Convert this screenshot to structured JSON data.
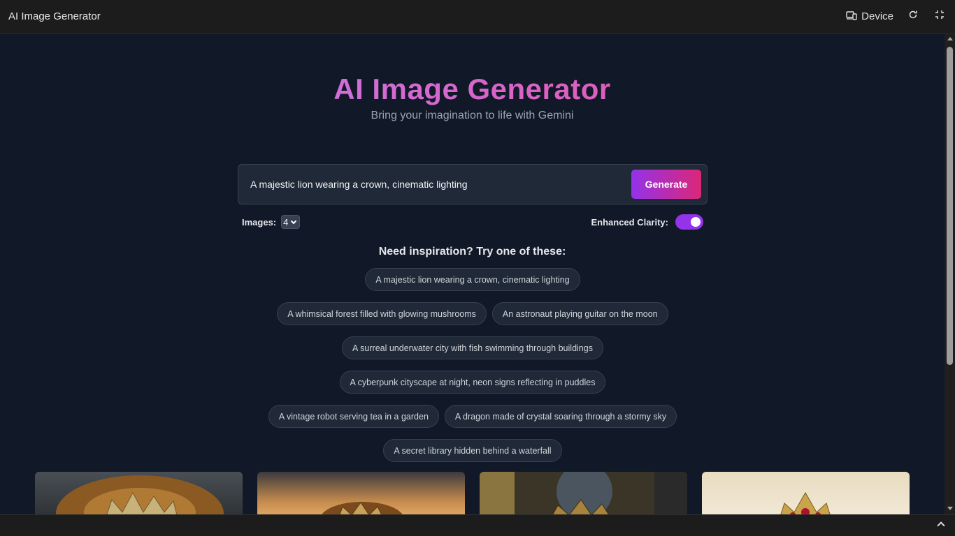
{
  "topbar": {
    "title": "AI Image Generator",
    "device_label": "Device"
  },
  "hero": {
    "title": "AI Image Generator",
    "subtitle": "Bring your imagination to life with Gemini"
  },
  "prompt": {
    "value": "A majestic lion wearing a crown, cinematic lighting",
    "generate_label": "Generate"
  },
  "options": {
    "images_label": "Images:",
    "images_value": "4",
    "clarity_label": "Enhanced Clarity:",
    "clarity_on": true
  },
  "inspiration": {
    "title": "Need inspiration? Try one of these:",
    "chips": [
      "A majestic lion wearing a crown, cinematic lighting",
      "A whimsical forest filled with glowing mushrooms",
      "An astronaut playing guitar on the moon",
      "A surreal underwater city with fish swimming through buildings",
      "A cyberpunk cityscape at night, neon signs reflecting in puddles",
      "A vintage robot serving tea in a garden",
      "A dragon made of crystal soaring through a stormy sky",
      "A secret library hidden behind a waterfall"
    ]
  },
  "colors": {
    "accent_start": "#9333ea",
    "accent_end": "#db2777",
    "background": "#111827"
  }
}
